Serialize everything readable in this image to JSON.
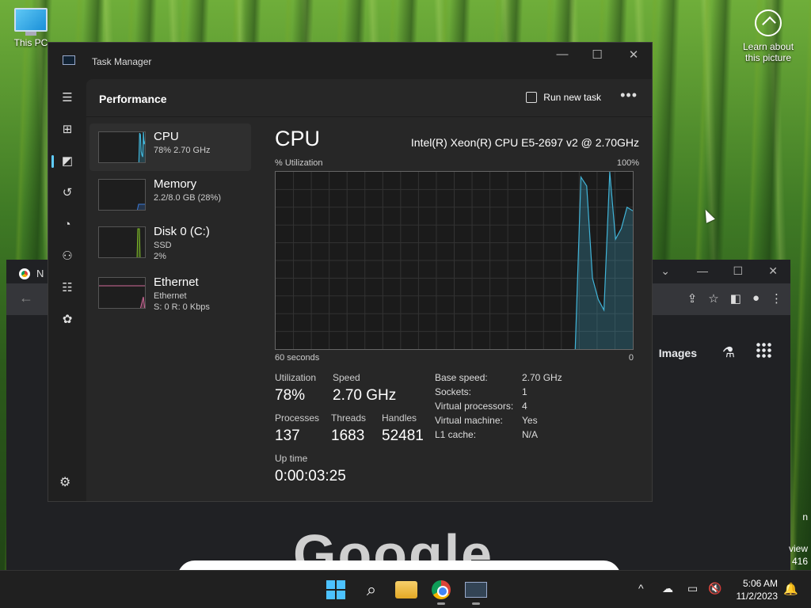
{
  "desktop": {
    "this_pc_label": "This PC",
    "learn_label": "Learn about this picture"
  },
  "chrome": {
    "tab_text": "N",
    "images_link": "Images",
    "logo_text": "Google",
    "side_text_1": "n",
    "side_text_2": "view",
    "side_text_3": "416"
  },
  "task_manager": {
    "title": "Task Manager",
    "section": "Performance",
    "run_new_task": "Run new task",
    "more": "•••",
    "sidebar": [
      {
        "name": "CPU",
        "sub1": "78%  2.70 GHz",
        "sub2": ""
      },
      {
        "name": "Memory",
        "sub1": "2.2/8.0 GB (28%)",
        "sub2": ""
      },
      {
        "name": "Disk 0 (C:)",
        "sub1": "SSD",
        "sub2": "2%"
      },
      {
        "name": "Ethernet",
        "sub1": "Ethernet",
        "sub2": "S: 0  R: 0 Kbps"
      }
    ],
    "detail": {
      "title": "CPU",
      "model": "Intel(R) Xeon(R) CPU E5-2697 v2 @ 2.70GHz",
      "util_label": "% Utilization",
      "util_max": "100%",
      "time_label": "60 seconds",
      "time_end": "0",
      "stats": {
        "utilization_label": "Utilization",
        "utilization": "78%",
        "speed_label": "Speed",
        "speed": "2.70 GHz",
        "processes_label": "Processes",
        "processes": "137",
        "threads_label": "Threads",
        "threads": "1683",
        "handles_label": "Handles",
        "handles": "52481",
        "uptime_label": "Up time",
        "uptime": "0:00:03:25"
      },
      "kv": [
        {
          "k": "Base speed:",
          "v": "2.70 GHz"
        },
        {
          "k": "Sockets:",
          "v": "1"
        },
        {
          "k": "Virtual processors:",
          "v": "4"
        },
        {
          "k": "Virtual machine:",
          "v": "Yes"
        },
        {
          "k": "L1 cache:",
          "v": "N/A"
        }
      ],
      "cpu_history": [
        0,
        0,
        0,
        0,
        0,
        0,
        0,
        0,
        0,
        0,
        0,
        0,
        0,
        0,
        0,
        0,
        0,
        0,
        0,
        0,
        0,
        0,
        0,
        0,
        0,
        0,
        0,
        0,
        0,
        0,
        0,
        0,
        0,
        0,
        0,
        0,
        0,
        0,
        0,
        0,
        0,
        0,
        0,
        0,
        0,
        0,
        0,
        0,
        0,
        0,
        0,
        0,
        0,
        97,
        92,
        40,
        28,
        22,
        100,
        62,
        68,
        80,
        78
      ]
    }
  },
  "taskbar": {
    "time": "5:06 AM",
    "date": "11/2/2023",
    "chevron": "^"
  },
  "colors": {
    "accent": "#60cdff",
    "cpu_line": "#41b4d8",
    "memory_line": "#3c7ad6",
    "disk_line": "#7db829",
    "eth_line": "#d16a9a"
  }
}
